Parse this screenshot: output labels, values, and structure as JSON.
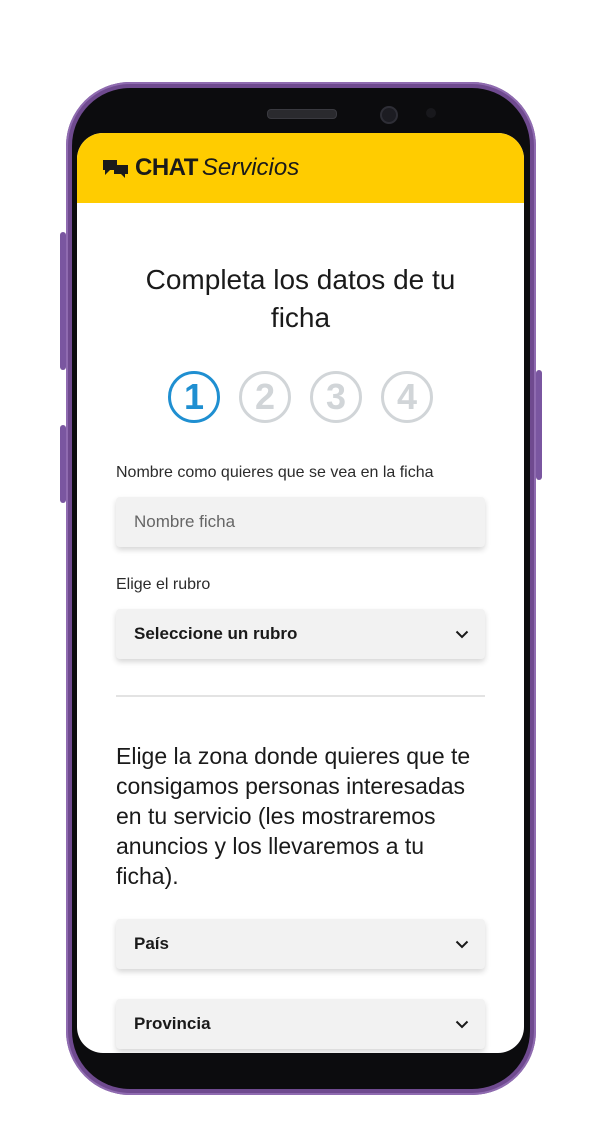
{
  "brand": {
    "chat": "CHAT",
    "servicios": "Servicios"
  },
  "title": "Completa los datos de tu ficha",
  "steps": [
    "1",
    "2",
    "3",
    "4"
  ],
  "active_step": 1,
  "accent_color": "#1f8fd1",
  "header_color": "#ffcc00",
  "name_field": {
    "label": "Nombre como quieres que se vea en la ficha",
    "placeholder": "Nombre ficha",
    "value": ""
  },
  "rubro_field": {
    "label": "Elige el rubro",
    "selected": "Seleccione un rubro"
  },
  "zone": {
    "heading": "Elige la zona donde quieres que te consigamos personas interesadas en tu servicio (les mostraremos anuncios y los llevaremos a tu ficha).",
    "pais": "País",
    "provincia": "Provincia"
  }
}
